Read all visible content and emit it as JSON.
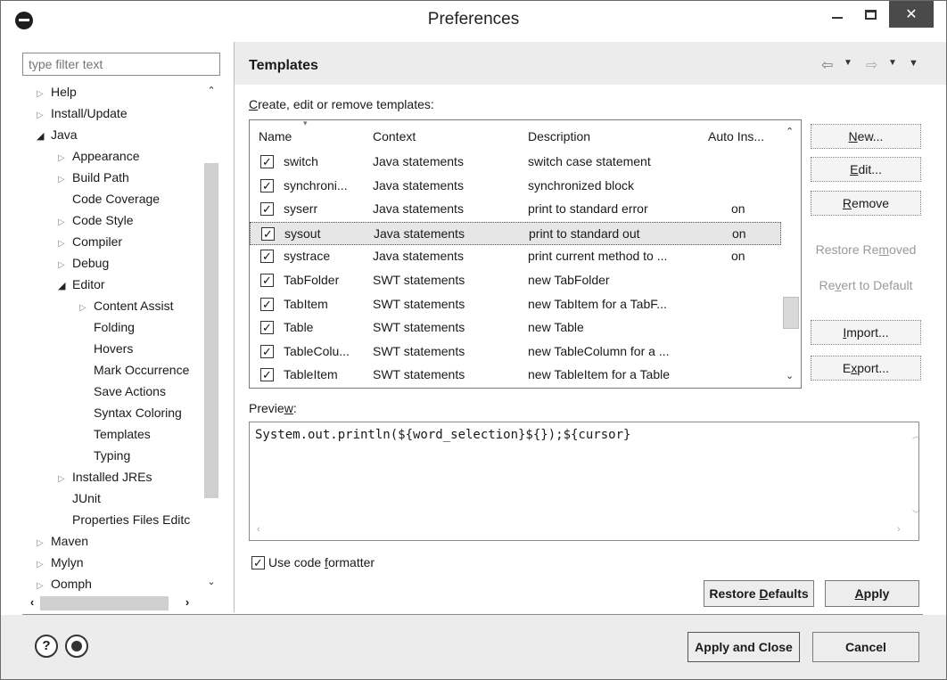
{
  "window": {
    "title": "Preferences"
  },
  "filter": {
    "placeholder": "type filter text"
  },
  "tree": [
    {
      "label": "Help",
      "depth": 0,
      "toggle": "collapsed"
    },
    {
      "label": "Install/Update",
      "depth": 0,
      "toggle": "collapsed"
    },
    {
      "label": "Java",
      "depth": 0,
      "toggle": "expanded"
    },
    {
      "label": "Appearance",
      "depth": 1,
      "toggle": "collapsed"
    },
    {
      "label": "Build Path",
      "depth": 1,
      "toggle": "collapsed"
    },
    {
      "label": "Code Coverage",
      "depth": 1,
      "toggle": "none"
    },
    {
      "label": "Code Style",
      "depth": 1,
      "toggle": "collapsed"
    },
    {
      "label": "Compiler",
      "depth": 1,
      "toggle": "collapsed"
    },
    {
      "label": "Debug",
      "depth": 1,
      "toggle": "collapsed"
    },
    {
      "label": "Editor",
      "depth": 1,
      "toggle": "expanded"
    },
    {
      "label": "Content Assist",
      "depth": 2,
      "toggle": "collapsed"
    },
    {
      "label": "Folding",
      "depth": 2,
      "toggle": "none"
    },
    {
      "label": "Hovers",
      "depth": 2,
      "toggle": "none"
    },
    {
      "label": "Mark Occurrence",
      "depth": 2,
      "toggle": "none"
    },
    {
      "label": "Save Actions",
      "depth": 2,
      "toggle": "none"
    },
    {
      "label": "Syntax Coloring",
      "depth": 2,
      "toggle": "none"
    },
    {
      "label": "Templates",
      "depth": 2,
      "toggle": "none"
    },
    {
      "label": "Typing",
      "depth": 2,
      "toggle": "none"
    },
    {
      "label": "Installed JREs",
      "depth": 1,
      "toggle": "collapsed"
    },
    {
      "label": "JUnit",
      "depth": 1,
      "toggle": "none"
    },
    {
      "label": "Properties Files Editc",
      "depth": 1,
      "toggle": "none"
    },
    {
      "label": "Maven",
      "depth": 0,
      "toggle": "collapsed"
    },
    {
      "label": "Mylyn",
      "depth": 0,
      "toggle": "collapsed"
    },
    {
      "label": "Oomph",
      "depth": 0,
      "toggle": "collapsed"
    }
  ],
  "page": {
    "title": "Templates",
    "section_label_u": "C",
    "section_label_rest": "reate, edit or remove templates:",
    "columns": [
      "Name",
      "Context",
      "Description",
      "Auto Ins..."
    ],
    "rows": [
      {
        "name": "switch",
        "context": "Java statements",
        "description": "switch case statement",
        "auto": "",
        "checked": true
      },
      {
        "name": "synchroni...",
        "context": "Java statements",
        "description": "synchronized block",
        "auto": "",
        "checked": true
      },
      {
        "name": "syserr",
        "context": "Java statements",
        "description": "print to standard error",
        "auto": "on",
        "checked": true
      },
      {
        "name": "sysout",
        "context": "Java statements",
        "description": "print to standard out",
        "auto": "on",
        "checked": true
      },
      {
        "name": "systrace",
        "context": "Java statements",
        "description": "print current method to ...",
        "auto": "on",
        "checked": true
      },
      {
        "name": "TabFolder",
        "context": "SWT statements",
        "description": "new TabFolder",
        "auto": "",
        "checked": true
      },
      {
        "name": "TabItem",
        "context": "SWT statements",
        "description": "new TabItem for a TabF...",
        "auto": "",
        "checked": true
      },
      {
        "name": "Table",
        "context": "SWT statements",
        "description": "new Table",
        "auto": "",
        "checked": true
      },
      {
        "name": "TableColu...",
        "context": "SWT statements",
        "description": "new TableColumn for a ...",
        "auto": "",
        "checked": true
      },
      {
        "name": "TableItem",
        "context": "SWT statements",
        "description": "new TableItem for a Table",
        "auto": "",
        "checked": true
      }
    ],
    "selected_row": "sysout",
    "buttons": {
      "new": {
        "u": "N",
        "rest": "ew..."
      },
      "edit": {
        "u": "E",
        "rest": "dit..."
      },
      "remove": {
        "u": "R",
        "rest": "emove"
      },
      "restore_removed": {
        "pre": "Restore Re",
        "u": "m",
        "rest": "oved"
      },
      "revert": {
        "pre": "Re",
        "u": "v",
        "rest": "ert to Default"
      },
      "import": {
        "u": "I",
        "rest": "mport..."
      },
      "export": {
        "pre": "E",
        "u": "x",
        "rest": "port..."
      }
    },
    "preview_label_pre": "Previe",
    "preview_label_u": "w",
    "preview_label_rest": ":",
    "preview_code": "System.out.println(${word_selection}${});${cursor}",
    "use_formatter_pre": "Use code ",
    "use_formatter_u": "f",
    "use_formatter_rest": "ormatter",
    "use_formatter_checked": true,
    "restore_defaults_pre": "Restore ",
    "restore_defaults_u": "D",
    "restore_defaults_rest": "efaults",
    "apply_u": "A",
    "apply_rest": "pply"
  },
  "footer": {
    "apply_close": "Apply and Close",
    "cancel": "Cancel",
    "help_glyph": "?"
  },
  "icons": {
    "check": "✓",
    "tree_collapsed": "▷",
    "tree_expanded": "◢",
    "close": "✕",
    "nav_back": "⇦",
    "nav_fwd": "⇨",
    "dropdown": "▼",
    "scroll_up": "⌃",
    "scroll_down": "⌄"
  }
}
